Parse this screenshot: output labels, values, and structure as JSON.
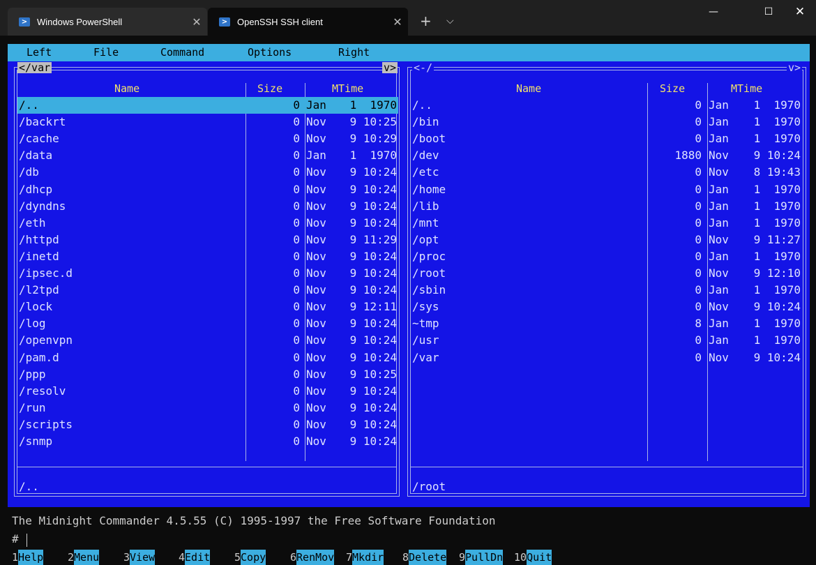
{
  "window": {
    "tabs": [
      {
        "title": "Windows PowerShell",
        "active": false
      },
      {
        "title": "OpenSSH SSH client",
        "active": true
      }
    ],
    "new_tab": "+",
    "dropdown": "⌵",
    "controls": {
      "minimize": "—",
      "maximize": "☐",
      "close": "✕"
    }
  },
  "menubar": [
    "Left",
    "File",
    "Command",
    "Options",
    "Right"
  ],
  "left_panel": {
    "path": "/var",
    "nav_left": "<",
    "nav_right": "v>",
    "columns": {
      "name": "Name",
      "size": "Size",
      "mtime": "MTime"
    },
    "rows": [
      {
        "name": "/..",
        "size": "0",
        "month": "Jan",
        "time": " 1  1970",
        "selected": true
      },
      {
        "name": "/backrt",
        "size": "0",
        "month": "Nov",
        "time": " 9 10:25"
      },
      {
        "name": "/cache",
        "size": "0",
        "month": "Nov",
        "time": " 9 10:29"
      },
      {
        "name": "/data",
        "size": "0",
        "month": "Jan",
        "time": " 1  1970"
      },
      {
        "name": "/db",
        "size": "0",
        "month": "Nov",
        "time": " 9 10:24"
      },
      {
        "name": "/dhcp",
        "size": "0",
        "month": "Nov",
        "time": " 9 10:24"
      },
      {
        "name": "/dyndns",
        "size": "0",
        "month": "Nov",
        "time": " 9 10:24"
      },
      {
        "name": "/eth",
        "size": "0",
        "month": "Nov",
        "time": " 9 10:24"
      },
      {
        "name": "/httpd",
        "size": "0",
        "month": "Nov",
        "time": " 9 11:29"
      },
      {
        "name": "/inetd",
        "size": "0",
        "month": "Nov",
        "time": " 9 10:24"
      },
      {
        "name": "/ipsec.d",
        "size": "0",
        "month": "Nov",
        "time": " 9 10:24"
      },
      {
        "name": "/l2tpd",
        "size": "0",
        "month": "Nov",
        "time": " 9 10:24"
      },
      {
        "name": "/lock",
        "size": "0",
        "month": "Nov",
        "time": " 9 12:11"
      },
      {
        "name": "/log",
        "size": "0",
        "month": "Nov",
        "time": " 9 10:24"
      },
      {
        "name": "/openvpn",
        "size": "0",
        "month": "Nov",
        "time": " 9 10:24"
      },
      {
        "name": "/pam.d",
        "size": "0",
        "month": "Nov",
        "time": " 9 10:24"
      },
      {
        "name": "/ppp",
        "size": "0",
        "month": "Nov",
        "time": " 9 10:25"
      },
      {
        "name": "/resolv",
        "size": "0",
        "month": "Nov",
        "time": " 9 10:24"
      },
      {
        "name": "/run",
        "size": "0",
        "month": "Nov",
        "time": " 9 10:24"
      },
      {
        "name": "/scripts",
        "size": "0",
        "month": "Nov",
        "time": " 9 10:24"
      },
      {
        "name": "/snmp",
        "size": "0",
        "month": "Nov",
        "time": " 9 10:24"
      }
    ],
    "mini_status": "/.."
  },
  "right_panel": {
    "path": "<-/",
    "nav_right": "v>",
    "columns": {
      "name": "Name",
      "size": "Size",
      "mtime": "MTime"
    },
    "rows": [
      {
        "name": "/..",
        "size": "0",
        "month": "Jan",
        "time": " 1  1970"
      },
      {
        "name": "/bin",
        "size": "0",
        "month": "Jan",
        "time": " 1  1970"
      },
      {
        "name": "/boot",
        "size": "0",
        "month": "Jan",
        "time": " 1  1970"
      },
      {
        "name": "/dev",
        "size": "1880",
        "month": "Nov",
        "time": " 9 10:24"
      },
      {
        "name": "/etc",
        "size": "0",
        "month": "Nov",
        "time": " 8 19:43"
      },
      {
        "name": "/home",
        "size": "0",
        "month": "Jan",
        "time": " 1  1970"
      },
      {
        "name": "/lib",
        "size": "0",
        "month": "Jan",
        "time": " 1  1970"
      },
      {
        "name": "/mnt",
        "size": "0",
        "month": "Jan",
        "time": " 1  1970"
      },
      {
        "name": "/opt",
        "size": "0",
        "month": "Nov",
        "time": " 9 11:27"
      },
      {
        "name": "/proc",
        "size": "0",
        "month": "Jan",
        "time": " 1  1970"
      },
      {
        "name": "/root",
        "size": "0",
        "month": "Nov",
        "time": " 9 12:10"
      },
      {
        "name": "/sbin",
        "size": "0",
        "month": "Jan",
        "time": " 1  1970"
      },
      {
        "name": "/sys",
        "size": "0",
        "month": "Nov",
        "time": " 9 10:24"
      },
      {
        "name": "~tmp",
        "size": "8",
        "month": "Jan",
        "time": " 1  1970"
      },
      {
        "name": "/usr",
        "size": "0",
        "month": "Jan",
        "time": " 1  1970"
      },
      {
        "name": "/var",
        "size": "0",
        "month": "Nov",
        "time": " 9 10:24"
      }
    ],
    "mini_status": "/root"
  },
  "terminal": {
    "copyright": "The Midnight Commander 4.5.55 (C) 1995-1997 the Free Software Foundation",
    "prompt": "#"
  },
  "fkeys": [
    {
      "num": "1",
      "label": "Help"
    },
    {
      "num": "2",
      "label": "Menu"
    },
    {
      "num": "3",
      "label": "View"
    },
    {
      "num": "4",
      "label": "Edit"
    },
    {
      "num": "5",
      "label": "Copy"
    },
    {
      "num": "6",
      "label": "RenMov"
    },
    {
      "num": "7",
      "label": "Mkdir"
    },
    {
      "num": "8",
      "label": "Delete"
    },
    {
      "num": "9",
      "label": "PullDn"
    },
    {
      "num": "10",
      "label": "Quit"
    }
  ],
  "colors": {
    "panel_bg": "#1414e6",
    "menu_bg": "#3caee0",
    "header_text": "#f2e26b",
    "terminal_bg": "#0c0c0c"
  }
}
